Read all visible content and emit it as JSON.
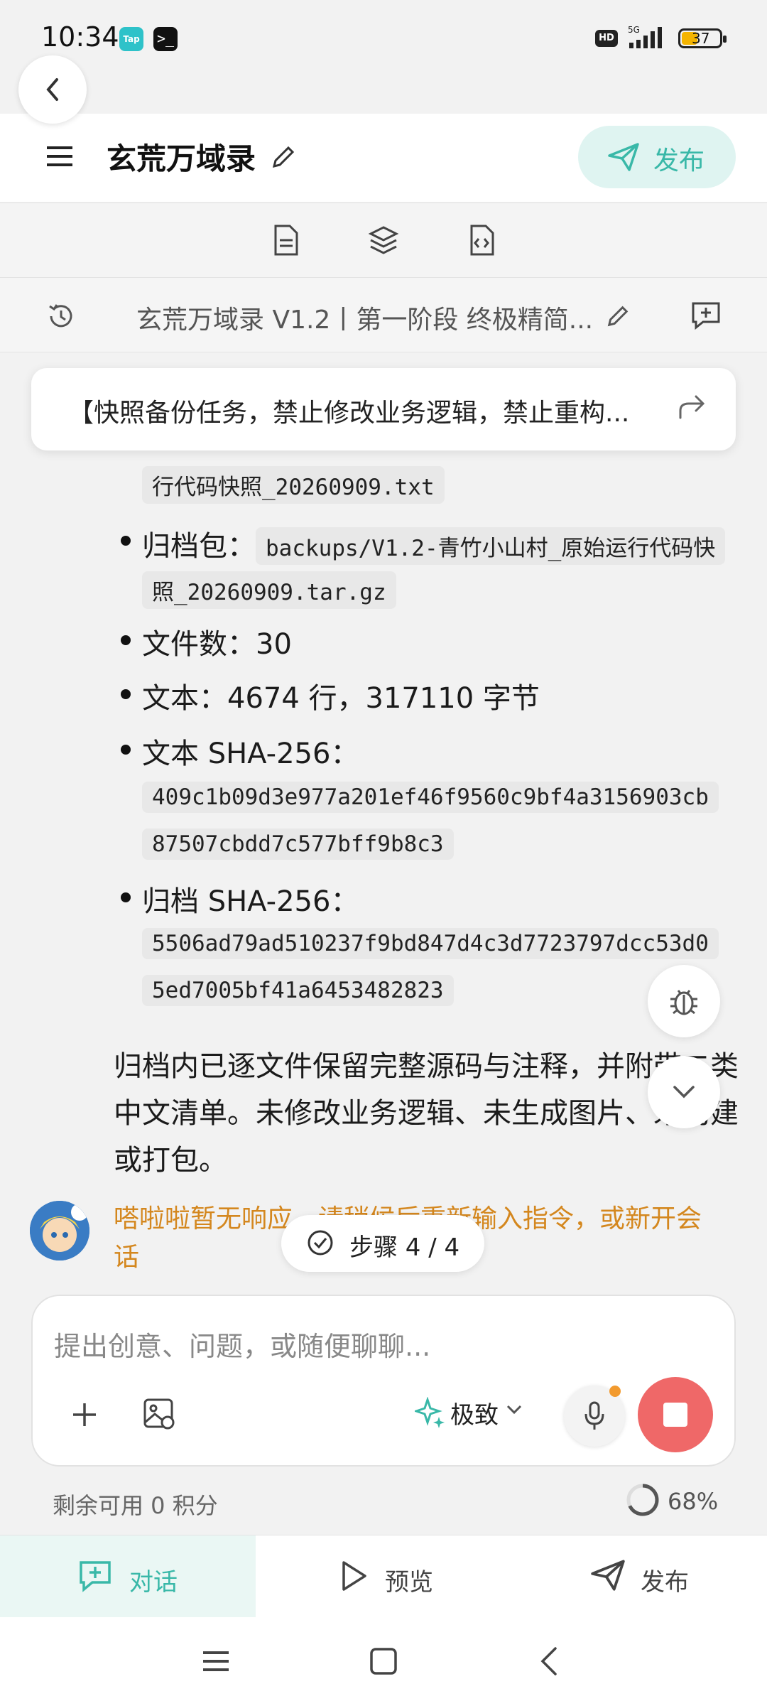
{
  "status_bar": {
    "time": "10:34",
    "app1": "Tap",
    "app2": ">_",
    "hd": "HD",
    "net": "5G",
    "battery": "37"
  },
  "header": {
    "title": "玄荒万域录",
    "publish_label": "发布"
  },
  "version_bar": {
    "title": "玄荒万域录 V1.2丨第一阶段 终极精简..."
  },
  "snapshot_bar": {
    "text": "【快照备份任务，禁止修改业务逻辑，禁止重构..."
  },
  "messages": {
    "list": [
      {
        "label": "",
        "code1": "行代码快照_20260909.txt"
      },
      {
        "label": "归档包：",
        "code1": "backups/V1.2-青竹小山村_原始运行代码快",
        "code2": "照_20260909.tar.gz"
      },
      {
        "text": "文件数：30"
      },
      {
        "text": "文本：4674 行，317110 字节"
      },
      {
        "label": "文本 SHA-256：",
        "code1": "409c1b09d3e977a201ef46f9560c9bf4a3156903cb",
        "code2": "87507cbdd7c577bff9b8c3"
      },
      {
        "label": "归档 SHA-256：",
        "code1": "5506ad79ad510237f9bd847d4c3d7723797dcc53d0",
        "code2": "5ed7005bf41a6453482823"
      }
    ],
    "para_lines": [
      "归档内已逐文件保留完整源码与注释，并附带二类",
      "中文清单。未修改业务逻辑、未生成图片、未构建",
      "或打包。"
    ],
    "warning_lines": [
      "嗒啦啦暂无响应，请稍候后重新输入指令，或新开会",
      "话"
    ]
  },
  "step_indicator": "步骤 4 / 4",
  "composer": {
    "placeholder": "提出创意、问题，或随便聊聊...",
    "mode": "极致"
  },
  "credits": "剩余可用 0 积分",
  "progress": {
    "label": "68%",
    "value": 0.68
  },
  "bottom_nav": [
    {
      "label": "对话",
      "active": true
    },
    {
      "label": "预览",
      "active": false
    },
    {
      "label": "发布",
      "active": false
    }
  ],
  "colors": {
    "accent": "#39b8a8",
    "warning": "#d4871e",
    "stop": "#ef6868"
  }
}
